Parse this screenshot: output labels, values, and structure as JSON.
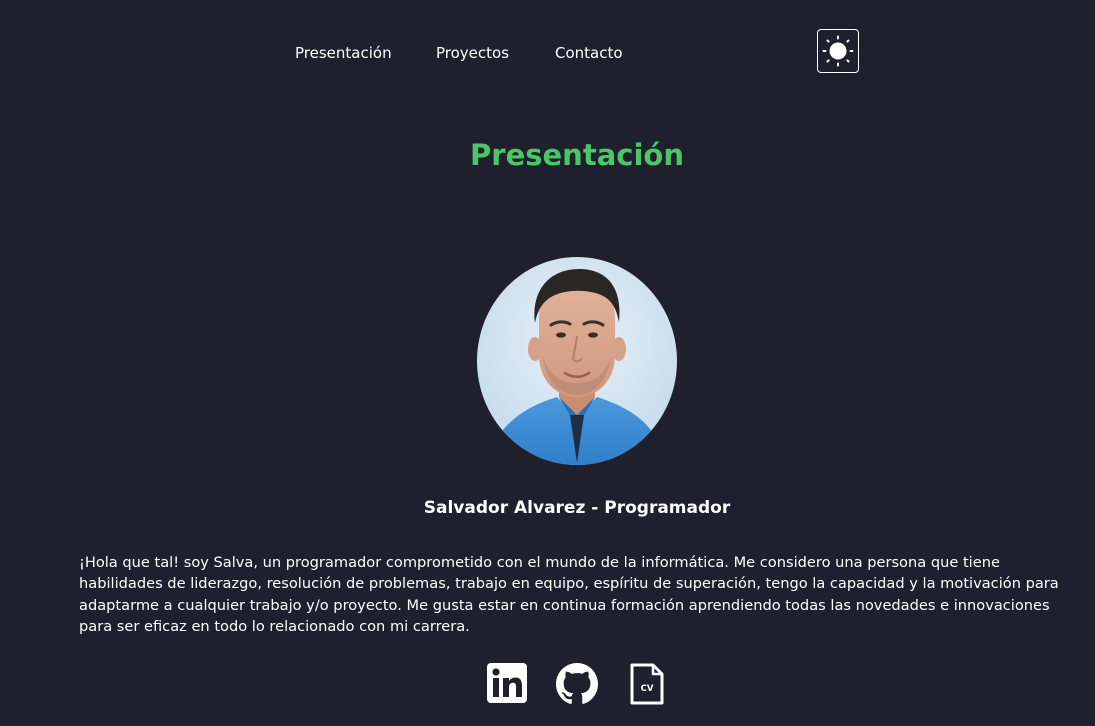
{
  "nav": {
    "items": [
      {
        "label": "Presentación"
      },
      {
        "label": "Proyectos"
      },
      {
        "label": "Contacto"
      }
    ],
    "theme_toggle_icon": "sun-icon"
  },
  "section": {
    "title": "Presentación"
  },
  "profile": {
    "name": "Salvador Alvarez - Programador",
    "bio": "¡Hola que tal! soy Salva, un programador comprometido con el mundo de la informática. Me considero una persona que tiene habilidades de liderazgo, resolución de problemas, trabajo en equipo, espíritu de superación, tengo la capacidad y la motivación para adaptarme a cualquier trabajo y/o proyecto. Me gusta estar en continua formación aprendiendo todas las novedades e innovaciones para ser eficaz en todo lo relacionado con mi carrera."
  },
  "socials": {
    "icons": [
      "linkedin-icon",
      "github-icon",
      "cv-icon"
    ],
    "cv_label": "CV"
  },
  "colors": {
    "background": "#201f2d",
    "accent": "#4cc766",
    "text": "#ffffff"
  }
}
